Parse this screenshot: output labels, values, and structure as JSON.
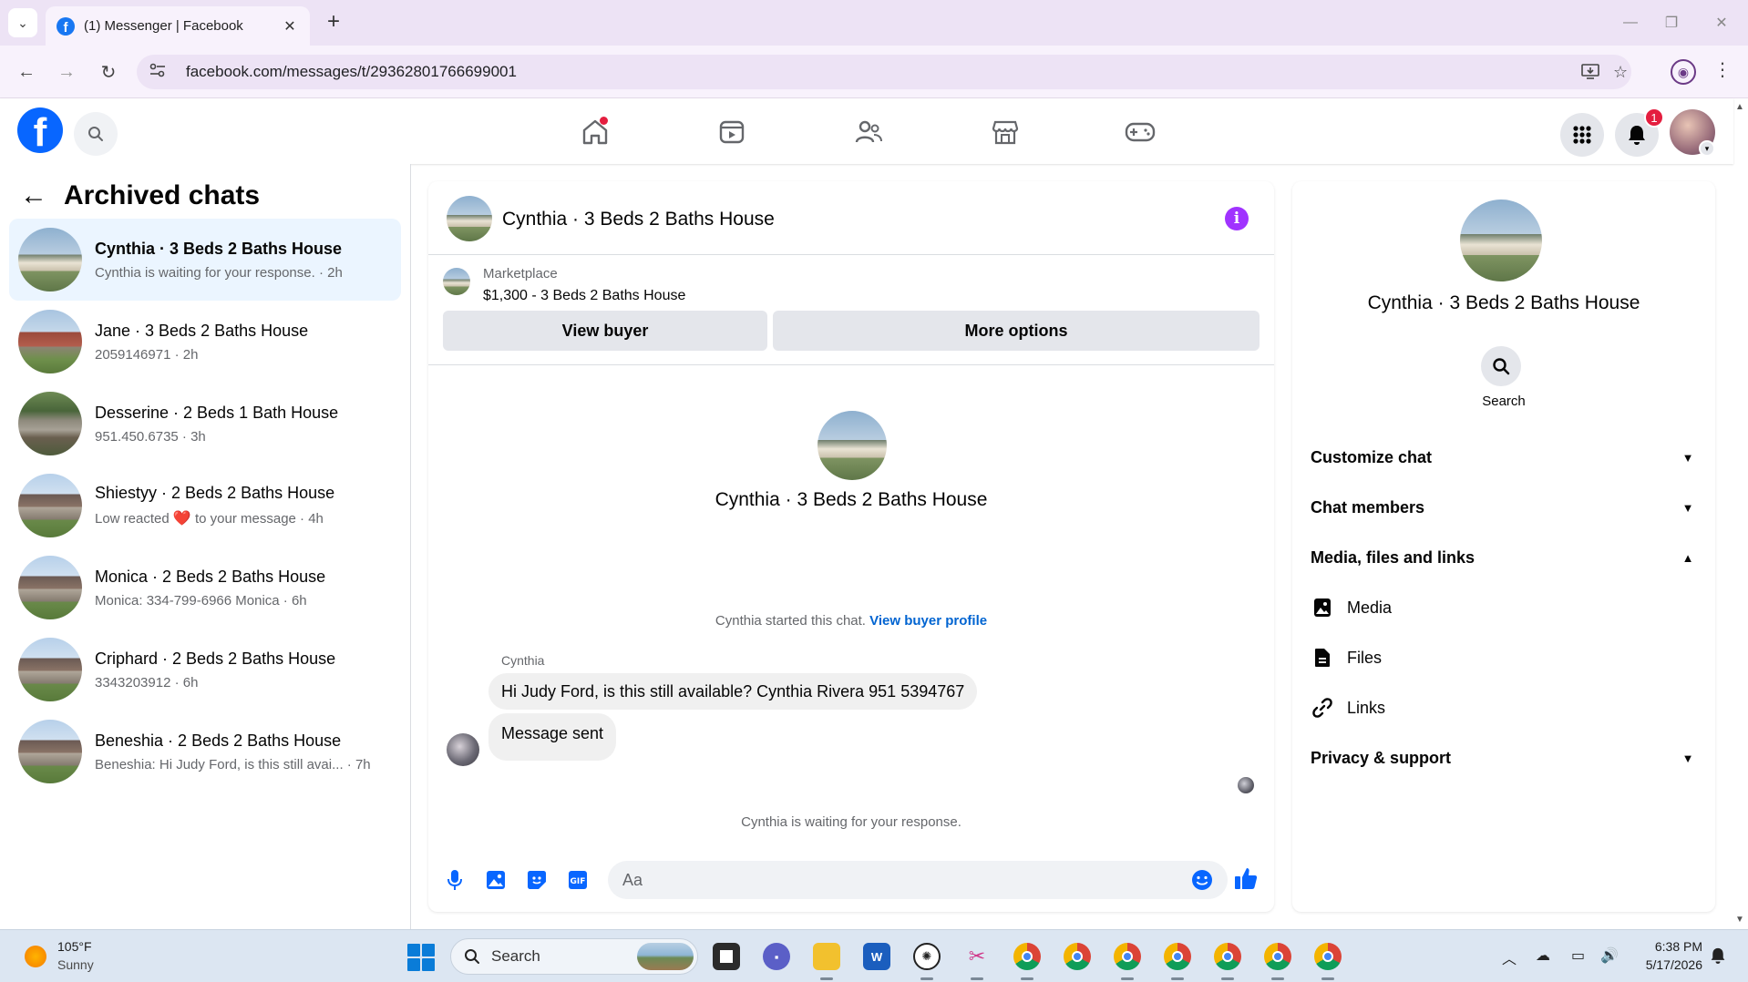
{
  "browser": {
    "tab_title": "(1) Messenger | Facebook",
    "tab_favicon": "f",
    "new_tab": "+",
    "url": "facebook.com/messages/t/29362801766699001",
    "win_minimize": "—",
    "win_restore": "❐",
    "win_close": "✕"
  },
  "facebook": {
    "logo_letter": "f",
    "notification_count": "1",
    "accent_color": "#0866ff"
  },
  "sidebar": {
    "title": "Archived chats",
    "chats": [
      {
        "name": "Cynthia · 3 Beds 2 Baths House",
        "preview": "Cynthia is waiting for your response. · 2h",
        "active": true
      },
      {
        "name": "Jane · 3 Beds 2 Baths House",
        "preview": "2059146971 · 2h"
      },
      {
        "name": "Desserine · 2 Beds 1 Bath House",
        "preview": "951.450.6735 · 3h"
      },
      {
        "name": "Shiestyy · 2 Beds 2 Baths House",
        "preview_prefix": "Low reacted",
        "preview_reaction": "❤️",
        "preview_suffix": "to your message · 4h"
      },
      {
        "name": "Monica · 2 Beds 2 Baths House",
        "preview": "Monica: 334-799-6966 Monica · 6h"
      },
      {
        "name": "Criphard · 2 Beds 2 Baths House",
        "preview": "3343203912 · 6h"
      },
      {
        "name": "Beneshia · 2 Beds 2 Baths House",
        "preview": "Beneshia: Hi Judy Ford, is this still avai... · 7h"
      }
    ]
  },
  "chat": {
    "header_name": "Cynthia · 3 Beds 2 Baths House",
    "info_icon": "i",
    "marketplace_label": "Marketplace",
    "listing": "$1,300 - 3 Beds 2 Baths House",
    "view_buyer": "View buyer",
    "more_options": "More options",
    "intro_name": "Cynthia · 3 Beds 2 Baths House",
    "started_text": "Cynthia started this chat.",
    "started_link": "View buyer profile",
    "sender": "Cynthia",
    "messages": [
      "Hi Judy Ford, is this still available? Cynthia Rivera 951 5394767",
      "Message sent"
    ],
    "waiting": "Cynthia is waiting for your response.",
    "composer_placeholder": "Aa"
  },
  "info_panel": {
    "name": "Cynthia · 3 Beds 2 Baths House",
    "search_label": "Search",
    "sections": [
      {
        "label": "Customize chat",
        "expanded": false
      },
      {
        "label": "Chat members",
        "expanded": false
      },
      {
        "label": "Media, files and links",
        "expanded": true
      },
      {
        "label": "Privacy & support",
        "expanded": false
      }
    ],
    "media_items": [
      "Media",
      "Files",
      "Links"
    ]
  },
  "taskbar": {
    "temp": "105°F",
    "weather": "Sunny",
    "search": "Search",
    "time": "6:38 PM",
    "date": "5/17/2026"
  }
}
